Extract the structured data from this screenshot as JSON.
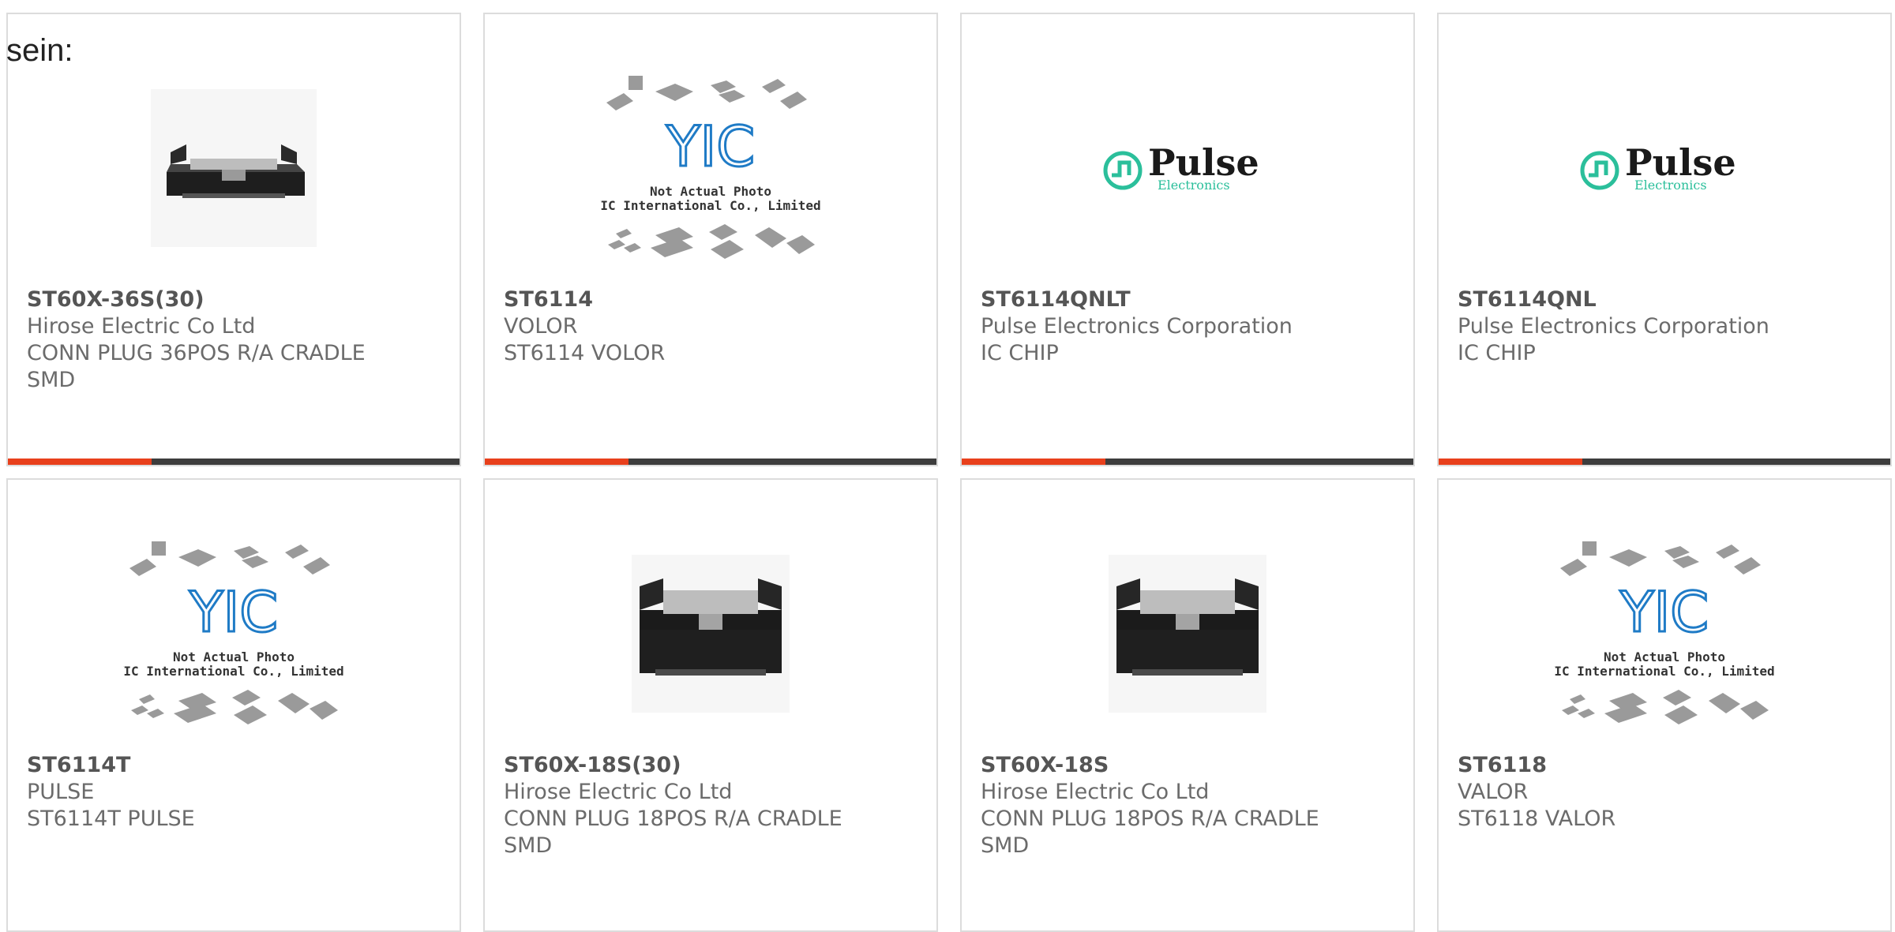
{
  "prefix_text": "sein:",
  "colors": {
    "accent": "#e8401c",
    "bar": "#3d3d3d",
    "pulse_green": "#2bbf9b",
    "yic_blue": "#1f7bc6"
  },
  "logos": {
    "yic_letters": "YIC",
    "yic_caption1": "Not Actual Photo",
    "yic_caption2": "YIC International Co., Limited.",
    "pulse_name": "Pulse",
    "pulse_sub": "Electronics"
  },
  "cards": [
    {
      "part": "ST60X-36S(30)",
      "mfr": "Hirose Electric Co Ltd",
      "desc": "CONN PLUG 36POS R/A CRADLE\nSMD",
      "image": "connector-36-image",
      "progress": 0.32
    },
    {
      "part": "ST6114",
      "mfr": "VOLOR",
      "desc": "ST6114 VOLOR",
      "image": "yic-not-actual-photo",
      "progress": 0.32
    },
    {
      "part": "ST6114QNLT",
      "mfr": "Pulse Electronics Corporation",
      "desc": "IC CHIP",
      "image": "pulse-logo",
      "progress": 0.32
    },
    {
      "part": "ST6114QNL",
      "mfr": "Pulse Electronics Corporation",
      "desc": "IC CHIP",
      "image": "pulse-logo",
      "progress": 0.32
    },
    {
      "part": "ST6114T",
      "mfr": "PULSE",
      "desc": "ST6114T PULSE",
      "image": "yic-not-actual-photo"
    },
    {
      "part": "ST60X-18S(30)",
      "mfr": "Hirose Electric Co Ltd",
      "desc": "CONN PLUG 18POS R/A CRADLE\nSMD",
      "image": "connector-18-image"
    },
    {
      "part": "ST60X-18S",
      "mfr": "Hirose Electric Co Ltd",
      "desc": "CONN PLUG 18POS R/A CRADLE\nSMD",
      "image": "connector-18-image"
    },
    {
      "part": "ST6118",
      "mfr": "VALOR",
      "desc": "ST6118 VALOR",
      "image": "yic-not-actual-photo"
    }
  ]
}
